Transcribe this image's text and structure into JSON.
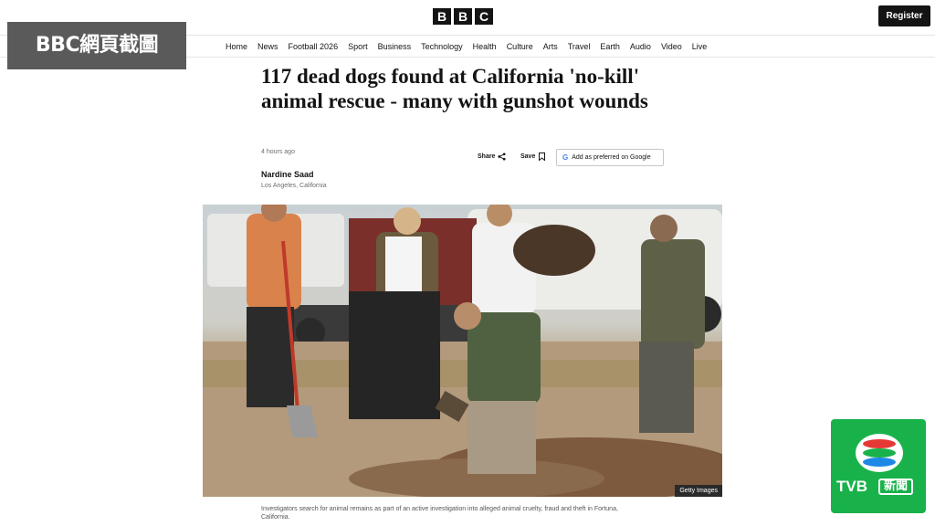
{
  "overlay": {
    "label": "BBC網頁截圖"
  },
  "header": {
    "logo_letters": [
      "B",
      "B",
      "C"
    ],
    "register_label": "Register"
  },
  "nav": {
    "items": [
      "Home",
      "News",
      "Football 2026",
      "Sport",
      "Business",
      "Technology",
      "Health",
      "Culture",
      "Arts",
      "Travel",
      "Earth",
      "Audio",
      "Video",
      "Live"
    ]
  },
  "article": {
    "headline": "117 dead dogs found at California 'no-kill' animal rescue - many with gunshot wounds",
    "timestamp": "4 hours ago",
    "share_label": "Share",
    "save_label": "Save",
    "google_label": "Add as preferred on Google",
    "author": "Nardine Saad",
    "location": "Los Angeles, California",
    "photo_credit": "Getty Images",
    "caption": "Investigators search for animal remains as part of an active investigation into alleged animal cruelty, fraud and theft in Fortuna, California."
  },
  "tvb": {
    "brand": "TVB",
    "news": "新聞"
  }
}
